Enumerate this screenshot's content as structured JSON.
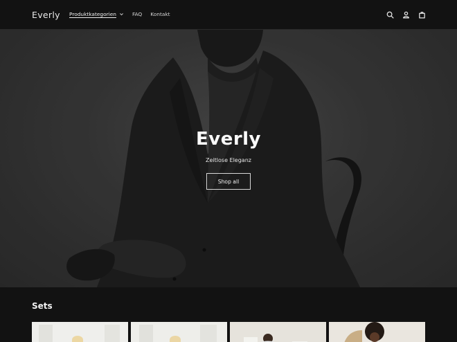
{
  "header": {
    "logo": "Everly",
    "nav": [
      {
        "label": "Produktkategorien",
        "active": true,
        "has_dropdown": true
      },
      {
        "label": "FAQ",
        "active": false,
        "has_dropdown": false
      },
      {
        "label": "Kontakt",
        "active": false,
        "has_dropdown": false
      }
    ],
    "icons": [
      "search-icon",
      "account-icon",
      "cart-icon"
    ]
  },
  "hero": {
    "title": "Everly",
    "subtitle": "Zeitlose Eleganz",
    "button_label": "Shop all"
  },
  "sets": {
    "title": "Sets",
    "products": [
      {
        "image": "product-image-1"
      },
      {
        "image": "product-image-2"
      },
      {
        "image": "product-image-3"
      },
      {
        "image": "product-image-4"
      }
    ]
  },
  "colors": {
    "background": "#121212",
    "text": "#ffffff"
  }
}
